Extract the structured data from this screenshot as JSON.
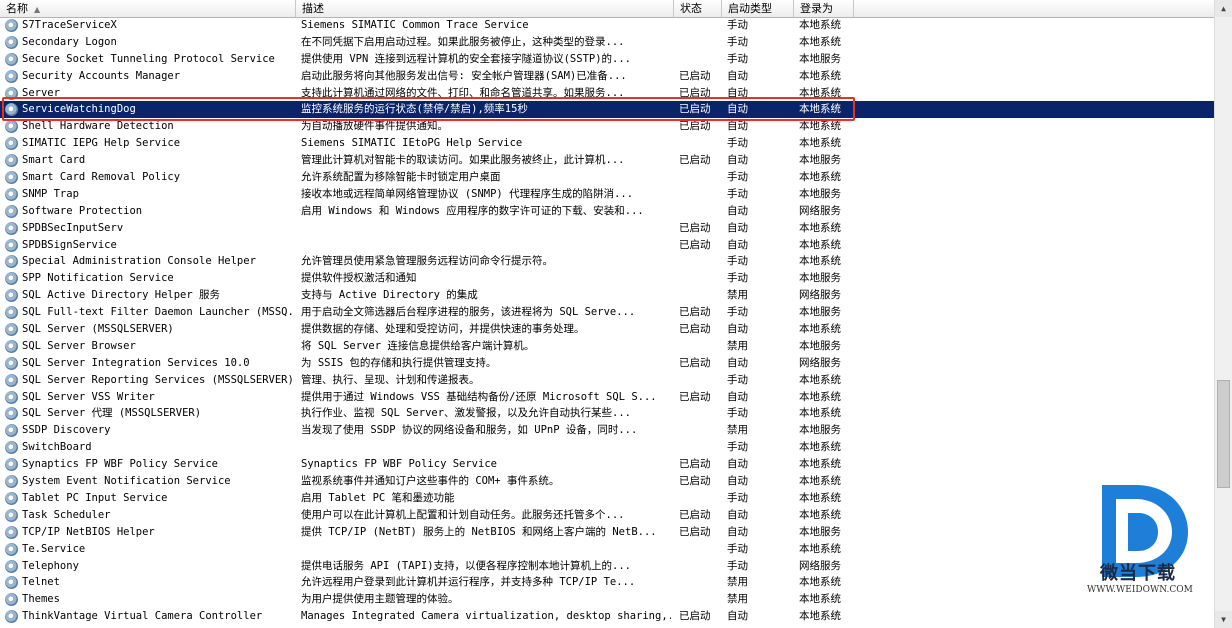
{
  "columns": {
    "name": "名称",
    "desc": "描述",
    "status": "状态",
    "start": "启动类型",
    "logon": "登录为"
  },
  "rows": [
    {
      "name": "S7TraceServiceX",
      "desc": "Siemens SIMATIC Common Trace Service",
      "status": "",
      "start": "手动",
      "logon": "本地系统"
    },
    {
      "name": "Secondary Logon",
      "desc": "在不同凭据下启用启动过程。如果此服务被停止，这种类型的登录...",
      "status": "",
      "start": "手动",
      "logon": "本地系统"
    },
    {
      "name": "Secure Socket Tunneling Protocol Service",
      "desc": "提供使用 VPN 连接到远程计算机的安全套接字隧道协议(SSTP)的...",
      "status": "",
      "start": "手动",
      "logon": "本地服务"
    },
    {
      "name": "Security Accounts Manager",
      "desc": "启动此服务将向其他服务发出信号: 安全帐户管理器(SAM)已准备...",
      "status": "已启动",
      "start": "自动",
      "logon": "本地系统"
    },
    {
      "name": "Server",
      "desc": "支持此计算机通过网络的文件、打印、和命名管道共享。如果服务...",
      "status": "已启动",
      "start": "自动",
      "logon": "本地系统"
    },
    {
      "name": "ServiceWatchingDog",
      "desc": "监控系统服务的运行状态(禁停/禁启),频率15秒",
      "status": "已启动",
      "start": "自动",
      "logon": "本地系统",
      "selected": true
    },
    {
      "name": "Shell Hardware Detection",
      "desc": "为自动播放硬件事件提供通知。",
      "status": "已启动",
      "start": "自动",
      "logon": "本地系统"
    },
    {
      "name": "SIMATIC IEPG Help Service",
      "desc": "Siemens SIMATIC IEtoPG Help Service",
      "status": "",
      "start": "手动",
      "logon": "本地系统"
    },
    {
      "name": "Smart Card",
      "desc": "管理此计算机对智能卡的取读访问。如果此服务被终止，此计算机...",
      "status": "已启动",
      "start": "自动",
      "logon": "本地服务"
    },
    {
      "name": "Smart Card Removal Policy",
      "desc": "允许系统配置为移除智能卡时锁定用户桌面",
      "status": "",
      "start": "手动",
      "logon": "本地系统"
    },
    {
      "name": "SNMP Trap",
      "desc": "接收本地或远程简单网络管理协议 (SNMP) 代理程序生成的陷阱消...",
      "status": "",
      "start": "手动",
      "logon": "本地服务"
    },
    {
      "name": "Software Protection",
      "desc": "启用 Windows 和 Windows 应用程序的数字许可证的下载、安装和...",
      "status": "",
      "start": "自动",
      "logon": "网络服务"
    },
    {
      "name": "SPDBSecInputServ",
      "desc": "",
      "status": "已启动",
      "start": "自动",
      "logon": "本地系统"
    },
    {
      "name": "SPDBSignService",
      "desc": "",
      "status": "已启动",
      "start": "自动",
      "logon": "本地系统"
    },
    {
      "name": "Special Administration Console Helper",
      "desc": "允许管理员使用紧急管理服务远程访问命令行提示符。",
      "status": "",
      "start": "手动",
      "logon": "本地系统"
    },
    {
      "name": "SPP Notification Service",
      "desc": "提供软件授权激活和通知",
      "status": "",
      "start": "手动",
      "logon": "本地服务"
    },
    {
      "name": "SQL Active Directory Helper 服务",
      "desc": "支持与 Active Directory 的集成",
      "status": "",
      "start": "禁用",
      "logon": "网络服务"
    },
    {
      "name": "SQL Full-text Filter Daemon Launcher (MSSQ...",
      "desc": "用于启动全文筛选器后台程序进程的服务，该进程将为 SQL Serve...",
      "status": "已启动",
      "start": "手动",
      "logon": "本地服务"
    },
    {
      "name": "SQL Server (MSSQLSERVER)",
      "desc": "提供数据的存储、处理和受控访问，并提供快速的事务处理。",
      "status": "已启动",
      "start": "自动",
      "logon": "本地系统"
    },
    {
      "name": "SQL Server Browser",
      "desc": "将 SQL Server 连接信息提供给客户端计算机。",
      "status": "",
      "start": "禁用",
      "logon": "本地服务"
    },
    {
      "name": "SQL Server Integration Services 10.0",
      "desc": "为 SSIS 包的存储和执行提供管理支持。",
      "status": "已启动",
      "start": "自动",
      "logon": "网络服务"
    },
    {
      "name": "SQL Server Reporting Services (MSSQLSERVER)",
      "desc": "管理、执行、呈现、计划和传递报表。",
      "status": "",
      "start": "手动",
      "logon": "本地系统"
    },
    {
      "name": "SQL Server VSS Writer",
      "desc": "提供用于通过 Windows VSS 基础结构备份/还原 Microsoft SQL S...",
      "status": "已启动",
      "start": "自动",
      "logon": "本地系统"
    },
    {
      "name": "SQL Server 代理 (MSSQLSERVER)",
      "desc": "执行作业、监视 SQL Server、激发警报，以及允许自动执行某些...",
      "status": "",
      "start": "手动",
      "logon": "本地系统"
    },
    {
      "name": "SSDP Discovery",
      "desc": "当发现了使用 SSDP 协议的网络设备和服务，如 UPnP 设备，同时...",
      "status": "",
      "start": "禁用",
      "logon": "本地服务"
    },
    {
      "name": "SwitchBoard",
      "desc": "",
      "status": "",
      "start": "手动",
      "logon": "本地系统"
    },
    {
      "name": "Synaptics FP WBF Policy Service",
      "desc": "Synaptics FP WBF Policy Service",
      "status": "已启动",
      "start": "自动",
      "logon": "本地系统"
    },
    {
      "name": "System Event Notification Service",
      "desc": "监视系统事件并通知订户这些事件的 COM+ 事件系统。",
      "status": "已启动",
      "start": "自动",
      "logon": "本地系统"
    },
    {
      "name": "Tablet PC Input Service",
      "desc": "启用 Tablet PC 笔和墨迹功能",
      "status": "",
      "start": "手动",
      "logon": "本地系统"
    },
    {
      "name": "Task Scheduler",
      "desc": "使用户可以在此计算机上配置和计划自动任务。此服务还托管多个...",
      "status": "已启动",
      "start": "自动",
      "logon": "本地系统"
    },
    {
      "name": "TCP/IP NetBIOS Helper",
      "desc": "提供 TCP/IP (NetBT) 服务上的 NetBIOS 和网络上客户端的 NetB...",
      "status": "已启动",
      "start": "自动",
      "logon": "本地服务"
    },
    {
      "name": "Te.Service",
      "desc": "",
      "status": "",
      "start": "手动",
      "logon": "本地系统"
    },
    {
      "name": "Telephony",
      "desc": "提供电话服务 API (TAPI)支持，以便各程序控制本地计算机上的...",
      "status": "",
      "start": "手动",
      "logon": "网络服务"
    },
    {
      "name": "Telnet",
      "desc": "允许远程用户登录到此计算机并运行程序，并支持多种 TCP/IP Te...",
      "status": "",
      "start": "禁用",
      "logon": "本地系统"
    },
    {
      "name": "Themes",
      "desc": "为用户提供使用主题管理的体验。",
      "status": "",
      "start": "禁用",
      "logon": "本地系统"
    },
    {
      "name": "ThinkVantage Virtual Camera Controller",
      "desc": "Manages Integrated Camera virtualization, desktop sharing,...",
      "status": "已启动",
      "start": "自动",
      "logon": "本地系统"
    }
  ],
  "watermark": {
    "text": "微当下载",
    "url": "WWW.WEIDOWN.COM"
  },
  "colors": {
    "selection": "#0a246a",
    "highlight_border": "#e4322b",
    "logo_blue": "#1e7fd8"
  }
}
